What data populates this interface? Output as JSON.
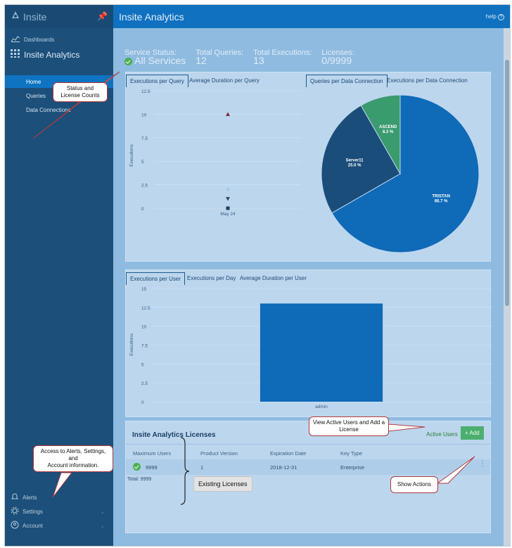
{
  "sidebar": {
    "brand": "Insite",
    "dashboards_label": "Dashboards",
    "app_title": "Insite Analytics",
    "nav": [
      "Home",
      "Queries",
      "Data Connections"
    ],
    "bottom": [
      "Alerts",
      "Settings",
      "Account"
    ]
  },
  "header": {
    "title": "Insite Analytics",
    "help_label": "help"
  },
  "status": {
    "service_status_label": "Service Status:",
    "service_status_value": "All Services",
    "total_queries_label": "Total Queries:",
    "total_queries_value": "12",
    "total_executions_label": "Total Executions:",
    "total_executions_value": "13",
    "licenses_label": "Licenses:",
    "licenses_value": "0/9999"
  },
  "panel1": {
    "tabs": [
      "Executions per Query",
      "Average Duration per Query",
      "Queries per Data Connection",
      "Executions per Data Connection"
    ]
  },
  "panel2": {
    "tabs": [
      "Executions per User",
      "Executions per Day",
      "Average Duration per User"
    ]
  },
  "licenses": {
    "title": "Insite Analytics Licenses",
    "active_users_label": "Active Users",
    "add_label": "+ Add",
    "columns": [
      "Maximum Users",
      "Product Version",
      "Expiration Date",
      "Key Type"
    ],
    "row": {
      "max_users": "9999",
      "version": "1",
      "expiration": "2018-12-31",
      "key_type": "Enterprise"
    },
    "total": "Total: 9999"
  },
  "callouts": {
    "status": "Status and\nLicense Counts",
    "sidebar_bottom": "Access to Alerts, Settings, and\nAccount information.",
    "active_users": "View Active Users and Add a\nLicense",
    "existing": "Existing Licenses",
    "actions": "Show Actions"
  },
  "colors": {
    "accent": "#0f71c0",
    "sidebar": "#1c4f7a",
    "content": "#8fbbe0",
    "green": "#4caf50"
  },
  "chart_data": [
    {
      "type": "scatter",
      "ylabel": "Executions",
      "ylim": [
        0,
        12.5
      ],
      "yticks": [
        "12.5",
        "10",
        "7.5",
        "5",
        "2.5",
        "0"
      ],
      "categories": [
        "May 24"
      ],
      "points": [
        {
          "x": "May 24",
          "y": 10,
          "marker": "triangle-up",
          "color": "#7a2a3a"
        },
        {
          "x": "May 24",
          "y": 2,
          "marker": "circle",
          "color": "#9ecbf0"
        },
        {
          "x": "May 24",
          "y": 1,
          "marker": "triangle-down",
          "color": "#2b4a63"
        },
        {
          "x": "May 24",
          "y": 0,
          "marker": "square",
          "color": "#1b3f62"
        }
      ]
    },
    {
      "type": "pie",
      "slices": [
        {
          "label": "TRISTAN",
          "value": 66.7,
          "text": "66.7 %",
          "color": "#0f6ab8"
        },
        {
          "label": "Server11",
          "value": 25.0,
          "text": "25.0 %",
          "color": "#1a4d79"
        },
        {
          "label": "ASCEND",
          "value": 8.3,
          "text": "8.3 %",
          "color": "#3a9b6f"
        }
      ]
    },
    {
      "type": "bar",
      "ylabel": "Executions",
      "ylim": [
        0,
        15
      ],
      "yticks": [
        "15",
        "12.5",
        "10",
        "7.5",
        "5",
        "2.5",
        "0"
      ],
      "categories": [
        "admin"
      ],
      "values": [
        13
      ]
    }
  ]
}
